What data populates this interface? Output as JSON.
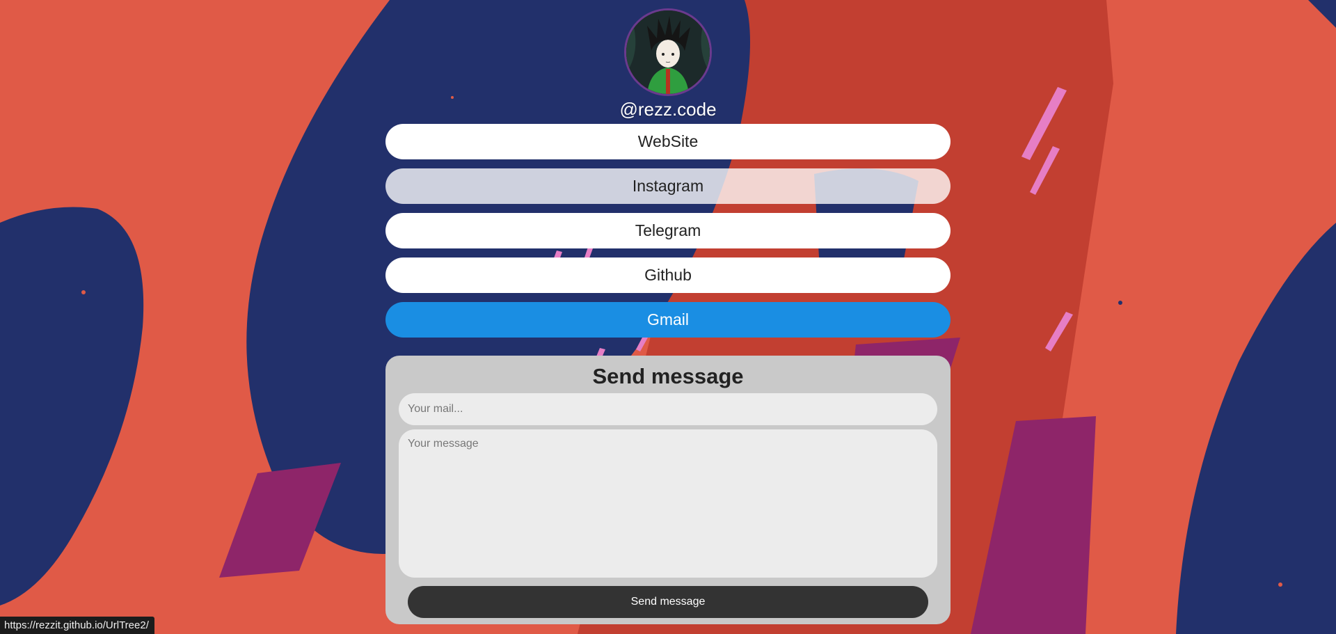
{
  "profile": {
    "handle": "@rezz.code",
    "avatar_icon": "anime-character-avatar"
  },
  "links": [
    {
      "label": "WebSite"
    },
    {
      "label": "Instagram"
    },
    {
      "label": "Telegram"
    },
    {
      "label": "Github"
    },
    {
      "label": "Gmail"
    }
  ],
  "contact_form": {
    "title": "Send message",
    "mail_placeholder": "Your mail...",
    "message_placeholder": "Your message",
    "send_label": "Send message"
  },
  "status_bar": {
    "url": "https://rezzit.github.io/UrlTree2/"
  },
  "colors": {
    "background_coral": "#e05a47",
    "background_navy": "#22306b",
    "background_red": "#c23f31",
    "background_purple": "#8e2569",
    "accent_pink": "#e67ec5",
    "gmail_blue": "#1a8ee3",
    "send_button": "#333333"
  }
}
